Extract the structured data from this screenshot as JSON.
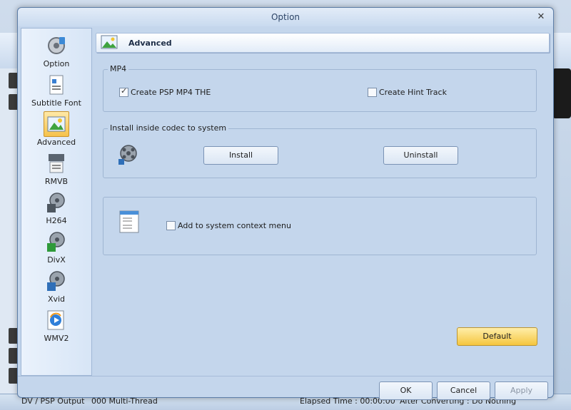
{
  "background": {
    "status_items": [
      "DV / PSP Output",
      "000 Multi-Thread",
      "Elapsed Time : 00:00:00",
      "After Converting : Do Nothing"
    ]
  },
  "dialog": {
    "title": "Option",
    "close_glyph": "✕"
  },
  "sidebar": {
    "items": [
      {
        "label": "Option",
        "icon": "option-icon"
      },
      {
        "label": "Subtitle Font",
        "icon": "subtitle-font-icon"
      },
      {
        "label": "Advanced",
        "icon": "advanced-icon",
        "active": true
      },
      {
        "label": "RMVB",
        "icon": "rmvb-icon"
      },
      {
        "label": "H264",
        "icon": "h264-icon"
      },
      {
        "label": "DivX",
        "icon": "divx-icon"
      },
      {
        "label": "Xvid",
        "icon": "xvid-icon"
      },
      {
        "label": "WMV2",
        "icon": "wmv2-icon"
      }
    ]
  },
  "header": {
    "title": "Advanced"
  },
  "mp4_group": {
    "legend": "MP4",
    "create_psp_label": "Create PSP MP4 THE",
    "create_psp_checked": true,
    "hint_track_label": "Create Hint Track",
    "hint_track_checked": false
  },
  "codec_group": {
    "legend": "Install inside codec to system",
    "install_label": "Install",
    "uninstall_label": "Uninstall"
  },
  "context_group": {
    "add_context_label": "Add to system context menu",
    "add_context_checked": false
  },
  "buttons": {
    "default_label": "Default",
    "ok_label": "OK",
    "cancel_label": "Cancel",
    "apply_label": "Apply"
  },
  "colors": {
    "accent": "#f5c63f",
    "dialog_bg": "#c4d6ec"
  }
}
